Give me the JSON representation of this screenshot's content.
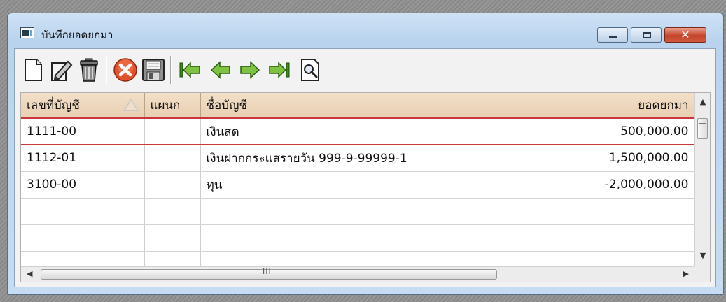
{
  "window": {
    "title": "บันทึกยอดยกมา"
  },
  "window_controls": {
    "close_glyph": "✕"
  },
  "toolbar": {
    "buttons": [
      "new-icon",
      "edit-icon",
      "delete-icon",
      "cancel-icon",
      "save-icon",
      "first-record-icon",
      "previous-record-icon",
      "next-record-icon",
      "last-record-icon",
      "search-icon"
    ]
  },
  "grid": {
    "columns": {
      "account_no": "เลขที่บัญชี",
      "department": "แผนก",
      "account_name": "ชื่อบัญชี",
      "balance": "ยอดยกมา"
    },
    "rows": [
      {
        "account_no": "1111-00",
        "department": "",
        "account_name": "เงินสด",
        "balance": "500,000.00"
      },
      {
        "account_no": "1112-01",
        "department": "",
        "account_name": "เงินฝากกระแสรายวัน 999-9-99999-1",
        "balance": "1,500,000.00"
      },
      {
        "account_no": "3100-00",
        "department": "",
        "account_name": "ทุน",
        "balance": "-2,000,000.00"
      }
    ]
  },
  "scrollbar": {
    "up_arrow": "▲",
    "down_arrow": "▼",
    "left_arrow": "◀",
    "right_arrow": "▶",
    "grip": "III"
  },
  "colors": {
    "header_bg": "#ecd5bb",
    "current_row_line": "#c8373a"
  }
}
